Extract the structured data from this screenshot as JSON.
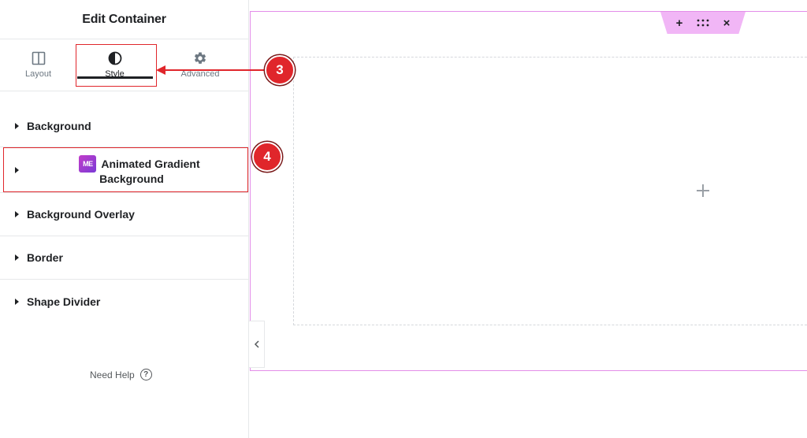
{
  "panel": {
    "title": "Edit Container",
    "tabs": [
      {
        "label": "Layout",
        "icon": "layout-columns-icon"
      },
      {
        "label": "Style",
        "icon": "contrast-half-circle-icon",
        "active": true
      },
      {
        "label": "Advanced",
        "icon": "gear-icon"
      }
    ],
    "sections": [
      {
        "label": "Background"
      },
      {
        "label": "Animated Gradient",
        "label_line2": "Background",
        "badge_icon": "wpmet-logo-icon",
        "badge_text": "ME"
      },
      {
        "label": "Background Overlay"
      },
      {
        "label": "Border"
      },
      {
        "label": "Shape Divider"
      }
    ],
    "need_help": "Need Help",
    "need_help_icon": "?"
  },
  "canvas": {
    "toolbar": {
      "add": "+",
      "drag": "drag-handle-icon",
      "close": "×"
    },
    "add_element_icon": "plus-icon"
  },
  "annotations": {
    "step3": "3",
    "step4": "4"
  },
  "colors": {
    "highlight": "#e0262b",
    "container_outline": "#e38de9",
    "toolbar_bg": "#f1b6f6",
    "logo_gradient_start": "#c13cc9",
    "logo_gradient_end": "#7b3bd6"
  }
}
